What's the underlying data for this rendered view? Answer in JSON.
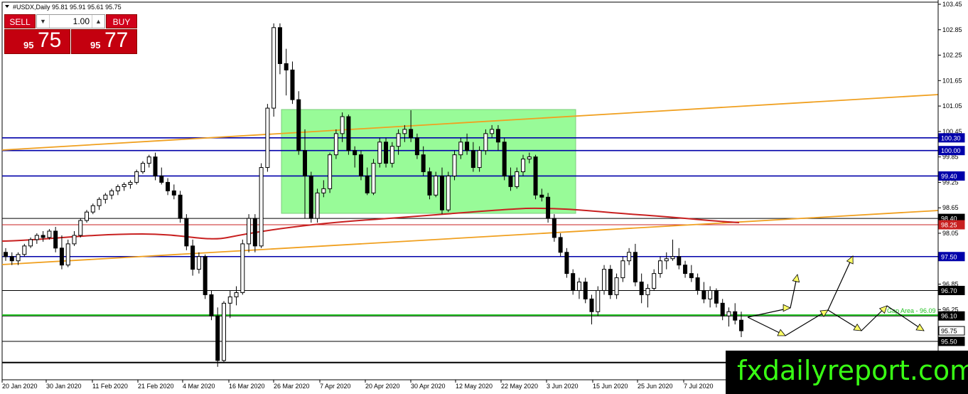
{
  "symbol_header": "#USDX,Daily  95.81 95.91 95.61 95.75",
  "trade_panel": {
    "sell_label": "SELL",
    "buy_label": "BUY",
    "lot_value": "1.00",
    "down_arrow": "▼",
    "up_arrow": "▲",
    "sell_price_small": "95",
    "sell_price_big": "75",
    "buy_price_small": "95",
    "buy_price_big": "77"
  },
  "watermark": "fxdailyreport.com",
  "colors": {
    "up_candle": "#ffffff",
    "down_candle": "#000000",
    "level_line": "#0000aa",
    "orange_line": "#f0a020",
    "red_ma": "#c82020",
    "green_zone": "#98fb98",
    "green_line": "#22c022",
    "tag_blue": "#0000aa",
    "tag_red": "#c82020",
    "tag_black": "#000000",
    "arrow_fill": "#ffff66"
  },
  "chart_data": {
    "type": "candlestick",
    "ylim": [
      95.3,
      103.45
    ],
    "y_ticks": [
      "103.45",
      "102.85",
      "102.25",
      "101.65",
      "101.05",
      "100.45",
      "99.85",
      "99.25",
      "98.65",
      "98.05",
      "96.85",
      "96.25"
    ],
    "x_ticks": [
      "20 Jan 2020",
      "30 Jan 2020",
      "11 Feb 2020",
      "21 Feb 2020",
      "4 Mar 2020",
      "16 Mar 2020",
      "26 Mar 2020",
      "7 Apr 2020",
      "20 Apr 2020",
      "30 Apr 2020",
      "12 May 2020",
      "22 May 2020",
      "3 Jun 2020",
      "15 Jun 2020",
      "25 Jun 2020",
      "7 Jul 2020"
    ],
    "level_tags": [
      {
        "label": "100.30",
        "value": 100.3,
        "color": "blue"
      },
      {
        "label": "100.00",
        "value": 100.0,
        "color": "blue"
      },
      {
        "label": "99.40",
        "value": 99.4,
        "color": "blue"
      },
      {
        "label": "98.40",
        "value": 98.4,
        "color": "black"
      },
      {
        "label": "98.25",
        "value": 98.25,
        "color": "red"
      },
      {
        "label": "97.50",
        "value": 97.5,
        "color": "blue"
      },
      {
        "label": "96.70",
        "value": 96.7,
        "color": "black"
      },
      {
        "label": "96.10",
        "value": 96.1,
        "color": "black"
      },
      {
        "label": "95.75",
        "value": 95.75,
        "color": "white"
      },
      {
        "label": "95.50",
        "value": 95.5,
        "color": "black"
      }
    ],
    "gap_label": "Gap Area - 96.09",
    "candles": [
      [
        97.6,
        97.7,
        97.4,
        97.5
      ],
      [
        97.5,
        97.6,
        97.3,
        97.4
      ],
      [
        97.4,
        97.6,
        97.3,
        97.55
      ],
      [
        97.55,
        97.8,
        97.5,
        97.75
      ],
      [
        97.75,
        97.95,
        97.7,
        97.9
      ],
      [
        97.9,
        98.05,
        97.8,
        98.0
      ],
      [
        98.0,
        98.1,
        97.85,
        97.95
      ],
      [
        97.95,
        98.15,
        97.9,
        98.1
      ],
      [
        98.1,
        98.2,
        97.6,
        97.7
      ],
      [
        97.7,
        98.0,
        97.2,
        97.3
      ],
      [
        97.3,
        97.9,
        97.25,
        97.8
      ],
      [
        97.8,
        98.1,
        97.75,
        98.0
      ],
      [
        98.0,
        98.4,
        97.95,
        98.35
      ],
      [
        98.35,
        98.6,
        98.3,
        98.55
      ],
      [
        98.55,
        98.75,
        98.5,
        98.7
      ],
      [
        98.7,
        98.9,
        98.6,
        98.85
      ],
      [
        98.85,
        99.0,
        98.75,
        98.95
      ],
      [
        98.95,
        99.1,
        98.85,
        99.05
      ],
      [
        99.05,
        99.2,
        98.95,
        99.15
      ],
      [
        99.15,
        99.25,
        99.05,
        99.2
      ],
      [
        99.2,
        99.3,
        99.1,
        99.25
      ],
      [
        99.25,
        99.55,
        99.2,
        99.5
      ],
      [
        99.5,
        99.75,
        99.45,
        99.7
      ],
      [
        99.7,
        99.9,
        99.6,
        99.85
      ],
      [
        99.85,
        99.95,
        99.3,
        99.4
      ],
      [
        99.4,
        99.6,
        99.2,
        99.25
      ],
      [
        99.25,
        99.35,
        98.95,
        99.05
      ],
      [
        99.05,
        99.2,
        98.85,
        98.95
      ],
      [
        98.95,
        99.05,
        98.3,
        98.4
      ],
      [
        98.4,
        98.5,
        97.65,
        97.75
      ],
      [
        97.75,
        97.9,
        97.05,
        97.2
      ],
      [
        97.2,
        97.6,
        97.1,
        97.5
      ],
      [
        97.5,
        97.55,
        96.5,
        96.6
      ],
      [
        96.6,
        96.7,
        96.0,
        96.1
      ],
      [
        96.1,
        96.3,
        94.9,
        95.05
      ],
      [
        95.05,
        96.45,
        95.0,
        96.4
      ],
      [
        96.4,
        96.7,
        96.05,
        96.55
      ],
      [
        96.55,
        96.8,
        96.35,
        96.65
      ],
      [
        96.65,
        97.9,
        96.6,
        97.8
      ],
      [
        97.8,
        98.5,
        97.6,
        98.4
      ],
      [
        98.4,
        98.5,
        97.6,
        97.75
      ],
      [
        97.75,
        99.7,
        97.7,
        99.6
      ],
      [
        99.6,
        101.1,
        99.5,
        101.0
      ],
      [
        101.0,
        103.0,
        100.8,
        102.9
      ],
      [
        102.9,
        103.0,
        101.8,
        102.05
      ],
      [
        102.05,
        102.4,
        101.3,
        101.9
      ],
      [
        101.9,
        102.1,
        101.1,
        101.2
      ],
      [
        101.2,
        101.4,
        99.9,
        100.0
      ],
      [
        100.0,
        100.5,
        98.4,
        99.4
      ],
      [
        99.4,
        99.5,
        98.3,
        98.4
      ],
      [
        98.4,
        99.1,
        98.3,
        99.0
      ],
      [
        99.0,
        99.3,
        98.9,
        99.1
      ],
      [
        99.1,
        99.95,
        99.0,
        99.9
      ],
      [
        99.9,
        100.5,
        99.8,
        100.4
      ],
      [
        100.4,
        100.9,
        100.2,
        100.8
      ],
      [
        100.8,
        100.85,
        99.9,
        100.0
      ],
      [
        100.0,
        100.1,
        99.6,
        99.9
      ],
      [
        99.9,
        100.0,
        99.3,
        99.4
      ],
      [
        99.4,
        99.6,
        98.95,
        99.0
      ],
      [
        99.0,
        99.8,
        98.95,
        99.7
      ],
      [
        99.7,
        100.3,
        99.6,
        100.2
      ],
      [
        100.2,
        100.3,
        99.6,
        99.7
      ],
      [
        99.7,
        100.2,
        99.6,
        100.1
      ],
      [
        100.1,
        100.5,
        99.9,
        100.4
      ],
      [
        100.4,
        100.6,
        100.2,
        100.5
      ],
      [
        100.5,
        100.95,
        100.2,
        100.3
      ],
      [
        100.3,
        100.4,
        99.8,
        99.9
      ],
      [
        99.9,
        100.1,
        99.4,
        99.5
      ],
      [
        99.5,
        99.6,
        98.85,
        98.95
      ],
      [
        98.95,
        99.5,
        98.9,
        99.4
      ],
      [
        99.4,
        99.6,
        98.5,
        98.6
      ],
      [
        98.6,
        99.5,
        98.55,
        99.4
      ],
      [
        99.4,
        100.0,
        99.3,
        99.9
      ],
      [
        99.9,
        100.3,
        99.8,
        100.2
      ],
      [
        100.2,
        100.4,
        99.9,
        100.0
      ],
      [
        100.0,
        100.2,
        99.5,
        99.6
      ],
      [
        99.6,
        100.1,
        99.5,
        100.0
      ],
      [
        100.0,
        100.5,
        99.9,
        100.4
      ],
      [
        100.4,
        100.6,
        100.3,
        100.5
      ],
      [
        100.5,
        100.6,
        100.0,
        100.2
      ],
      [
        100.2,
        100.3,
        99.3,
        99.4
      ],
      [
        99.4,
        99.6,
        99.05,
        99.15
      ],
      [
        99.15,
        99.6,
        99.1,
        99.5
      ],
      [
        99.5,
        99.9,
        99.4,
        99.8
      ],
      [
        99.8,
        99.95,
        99.7,
        99.85
      ],
      [
        99.85,
        99.9,
        98.85,
        98.95
      ],
      [
        98.95,
        99.1,
        98.8,
        98.9
      ],
      [
        98.9,
        99.0,
        98.3,
        98.4
      ],
      [
        98.4,
        98.5,
        97.85,
        97.95
      ],
      [
        97.95,
        98.05,
        97.5,
        97.6
      ],
      [
        97.6,
        97.7,
        97.0,
        97.1
      ],
      [
        97.1,
        97.2,
        96.6,
        96.7
      ],
      [
        96.7,
        97.0,
        96.5,
        96.9
      ],
      [
        96.9,
        97.0,
        96.4,
        96.5
      ],
      [
        96.5,
        96.6,
        95.9,
        96.2
      ],
      [
        96.2,
        96.8,
        96.1,
        96.7
      ],
      [
        96.7,
        97.3,
        96.6,
        97.2
      ],
      [
        97.2,
        97.3,
        96.5,
        96.6
      ],
      [
        96.6,
        97.1,
        96.5,
        97.0
      ],
      [
        97.0,
        97.5,
        96.9,
        97.4
      ],
      [
        97.4,
        97.7,
        97.3,
        97.6
      ],
      [
        97.6,
        97.8,
        96.8,
        96.9
      ],
      [
        96.9,
        97.1,
        96.4,
        96.6
      ],
      [
        96.6,
        96.85,
        96.3,
        96.75
      ],
      [
        96.75,
        97.2,
        96.7,
        97.1
      ],
      [
        97.1,
        97.5,
        97.0,
        97.4
      ],
      [
        97.4,
        97.6,
        97.2,
        97.45
      ],
      [
        97.45,
        97.9,
        97.4,
        97.5
      ],
      [
        97.5,
        97.7,
        97.2,
        97.3
      ],
      [
        97.3,
        97.4,
        97.0,
        97.1
      ],
      [
        97.1,
        97.3,
        96.9,
        97.0
      ],
      [
        97.0,
        97.1,
        96.6,
        96.7
      ],
      [
        96.7,
        96.9,
        96.4,
        96.5
      ],
      [
        96.5,
        96.8,
        96.3,
        96.7
      ],
      [
        96.7,
        96.75,
        96.3,
        96.4
      ],
      [
        96.4,
        96.5,
        96.0,
        96.1
      ],
      [
        96.1,
        96.3,
        95.85,
        96.2
      ],
      [
        96.2,
        96.4,
        95.9,
        96.0
      ],
      [
        96.0,
        96.2,
        95.6,
        95.75
      ]
    ]
  }
}
